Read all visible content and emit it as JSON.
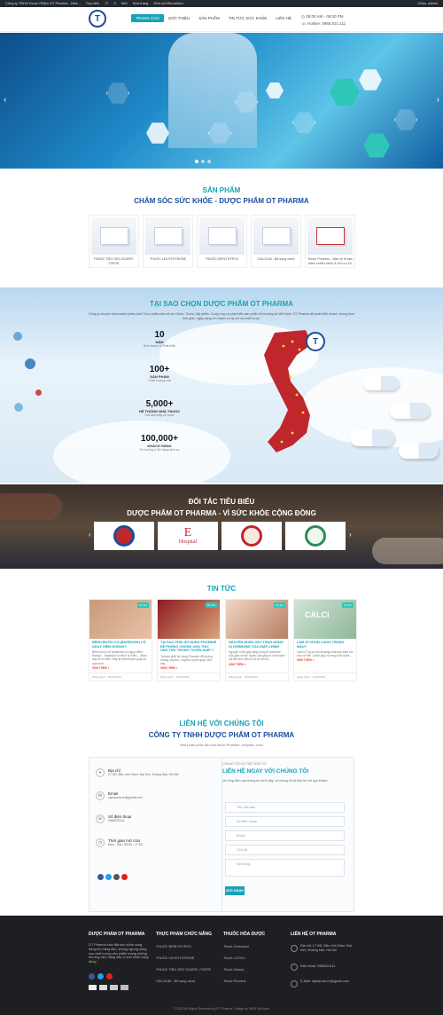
{
  "wpbar": {
    "site": "Công ty TNHH Dược Phẩm OT Pharma - Nhà...",
    "items": [
      "Tùy biến",
      "17",
      "0",
      "Mới",
      "Sửa trang",
      "Sửa với Elementor"
    ],
    "user": "Chào, admin"
  },
  "header": {
    "nav": [
      "TRANG CHỦ",
      "GIỚI THIỆU",
      "SẢN PHẨM",
      "TIN TỨC SỨC KHỎE",
      "LIÊN HỆ"
    ],
    "hours": "08:00 AM - 05:00 PM",
    "hotline": "Hotline: 0965.021.111"
  },
  "products": {
    "kicker": "SẢN PHẨM",
    "title": "CHĂM SÓC SỨC KHỎE - DƯỢC PHẨM OT PHARMA",
    "items": [
      "THUỐC TIÊU SEO SCARFI, FORTE",
      "THUỐC LEVOTHYRONE",
      "THUỐC BERLTHYROX",
      "CALCIUM - Bổ sung canxi",
      "Thuốc Promine – Bảo vệ tế bào tránh nhiễm bệnh & tối ưu 120"
    ]
  },
  "why": {
    "title": "TẠI SAO CHỌN DƯỢC PHẨM OT PHARMA",
    "desc": "Công ty chuyên kinh doanh phân phối Thực phẩm bảo vệ sức khỏe, Thuốc, Mỹ phẩm. Cung ứng và phát triển sản phẩm thị trường tại Việt Nam. OT Pharma đã phát triển nhanh chóng theo thời gian, ngày càng lớn mạnh có uy mô và chiến lược.",
    "stats": [
      {
        "n": "10",
        "l": "NĂM",
        "d": "Hình thành & Phát triển"
      },
      {
        "n": "100+",
        "l": "SẢN PHẨM",
        "d": "Chất Lượng cao"
      },
      {
        "n": "5,000+",
        "l": "HỆ THỐNG NHÀ THUỐC",
        "d": "Trải dài khắp cả nước"
      },
      {
        "n": "100,000+",
        "l": "KHÁCH HÀNG",
        "d": "Tin tưởng & Sử dụng dịch vụ"
      }
    ]
  },
  "partners": {
    "kicker": "ĐỐI TÁC TIÊU BIỂU",
    "title": "DƯỢC PHẨM OT PHARMA - VÌ SỨC KHỎE CỘNG ĐỒNG",
    "logo2": "Hospital"
  },
  "news": {
    "title": "TIN TỨC",
    "items": [
      {
        "t": "BỆNH BƯỚU CỔ (BASEDOW) CÓ NGUY HIỂM KHÔNG?",
        "x": "Bệnh bướu cổ (basedow có nguy hiểm không? - Basedow là bệnh lý miễn... được xảy ra tự miễn. Đây là bệnh tuyến giáp do quá trình...",
        "m": "XEM THÊM »",
        "d": "Hằng Senh  ·  05/27/2023"
      },
      {
        "t": "TẠI SAO PHẢI SỬ DỤNG PROMINE ĐỂ PHÒNG CHỐNG UNG THƯ, UNG THƯ TRONG TUYẾN GIÁP ?",
        "x": "Tại sao phải sử dụng Promine để phòng chống ung thư, ung thư tuyến giáp, đến nay...",
        "m": "XEM THÊM »",
        "d": "Hằng Senh  ·  10/01/2023"
      },
      {
        "t": "NGUYÊN NHÂN GÂY TĂNG HỒNG DỊ HORMONE CỦA GIÁP CHÍNH",
        "x": "Nguyên nhân gây tăng hồng dị hormone của giáp chính, tuyến của giáp là một tuyến nội tiết nhỏ nằm ở cổ có vai trò...",
        "m": "XEM THÊM »",
        "d": "Hằng Senh  ·  10/01/2023"
      },
      {
        "t": "LÀM GÌ KHI BỊ CANXI TRONG MÁU?",
        "x": "Canxi (Ca) là một khoáng chất cần thiết với mọi cơ thể. Canxi giúp xương chắc khỏe...",
        "m": "XEM THÊM »",
        "d": "Hằng Senh  ·  11/16/2023"
      }
    ]
  },
  "contact": {
    "kicker": "LIÊN HỆ VỚI CHÚNG TÔI",
    "title": "CÔNG TY TNHH DƯỢC PHẨM OT PHARMA",
    "sub": "Nhà phân phối các loại thuốc Promine, smycan, cocu",
    "info": [
      {
        "t": "Địa chỉ",
        "v": "17 KĐ, Bắc Linh Đàm, Đại Kim, Hoàng Mai, Hà Nội"
      },
      {
        "t": "Email",
        "v": "otpharma.vn@gmail.com"
      },
      {
        "t": "Số điện thoại",
        "v": "0965021111"
      },
      {
        "t": "Thời gian mở cửa",
        "v": "Mon - Sat / 08:00 - 17:00"
      }
    ],
    "form_kicker": "CHÚNG TÔI CÓ THỂ GIÚP GÌ?",
    "form_title": "LIÊN HỆ NGAY VỚI CHÚNG TÔI",
    "form_desc": "Vui lòng điền vào thông tin dưới đây, và chúng tôi sẽ liên hệ với quý khách.",
    "ph": [
      "Tên của bạn",
      "Số Điện thoại",
      "Email",
      "Chủ đề",
      "Nội dung"
    ],
    "submit": "GỬI NGAY"
  },
  "footer": {
    "cols": [
      {
        "h": "DƯỢC PHẨM OT PHARMA",
        "items": [
          "OT Pharma luôn đặt sức khỏe cộng đồng lên hàng đầu, không ngừng nâng cao chất lượng sản phẩm mang những thương hiệu hàng đầu vì sức khỏe cộng đồng."
        ]
      },
      {
        "h": "THỰC PHẨM CHỨC NĂNG",
        "items": [
          "THUỐC BERLTHYROX",
          "THUỐC LEVOTHYRONE",
          "THUỐC TIÊU SEO SCARFI, FORTE",
          "CALCIUM - Bổ sung canxi"
        ]
      },
      {
        "h": "THUỐC HÓA DƯỢC",
        "items": [
          "Thuốc Cerecesel",
          "Thuốc I-COOL",
          "Thuốc Kidney",
          "Thuốc Promine"
        ]
      },
      {
        "h": "LIÊN HỆ OT PHARMA",
        "items": [
          "Địa chỉ: 17 KĐ, Bắc Linh Đàm, Đại Kim, Hoàng Mai, Hà Nội",
          "Điện thoại: 0965021111",
          "E-Mail: otpharma.vn@gmail.com"
        ]
      }
    ],
    "copy": "© 2023 All Rights Reserved by OT Pharma. Design by WEB Việt Nam"
  }
}
